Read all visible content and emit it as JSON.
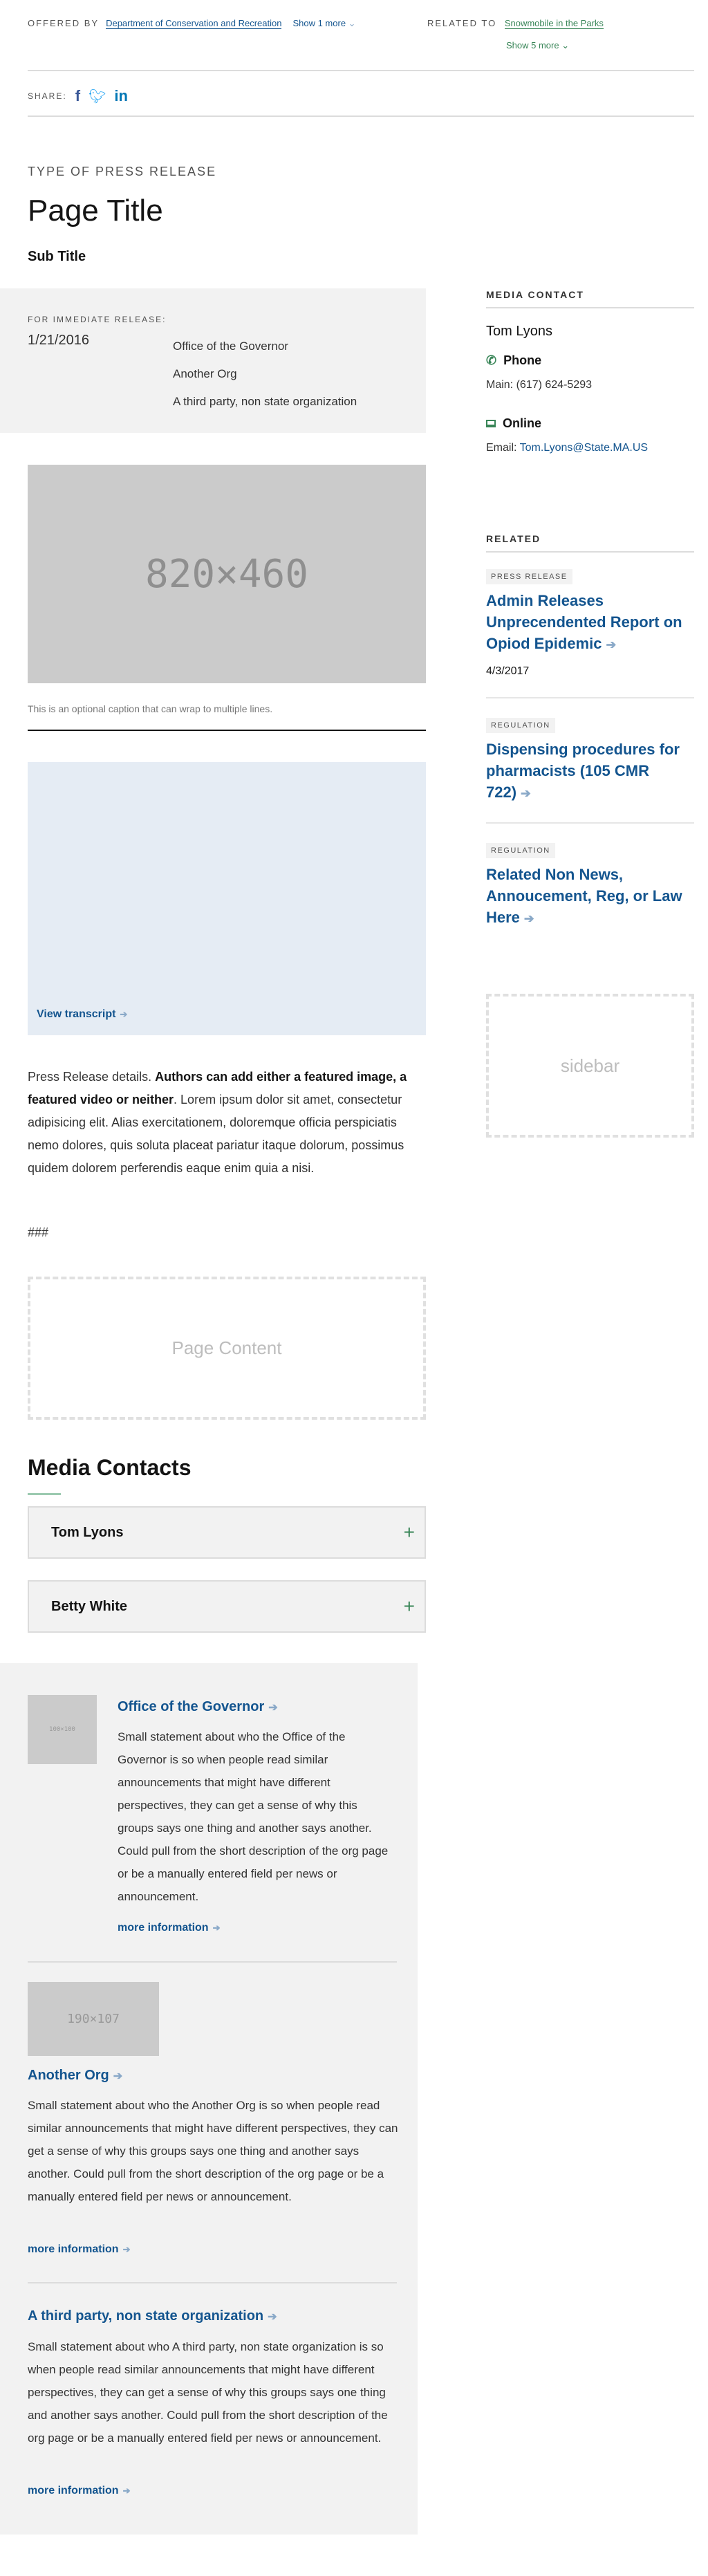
{
  "header": {
    "offered_by_label": "OFFERED BY",
    "offered_by_link": "Department of Conservation and Recreation",
    "offered_by_more": "Show 1 more",
    "related_to_label": "RELATED TO",
    "related_to_link": "Snowmobile in the Parks",
    "related_to_more": "Show 5 more",
    "share_label": "SHARE:",
    "share_icons": [
      "facebook-icon",
      "twitter-icon",
      "linkedin-icon"
    ]
  },
  "title_block": {
    "type": "TYPE OF PRESS RELEASE",
    "title": "Page Title",
    "subtitle": "Sub Title"
  },
  "release": {
    "label": "FOR IMMEDIATE RELEASE:",
    "date": "1/21/2016",
    "orgs": [
      "Office of the Governor",
      "Another Org",
      "A third party, non state organization"
    ]
  },
  "featured_image": {
    "placeholder": "820×460",
    "caption": "This is an optional caption that can wrap to multiple lines."
  },
  "video": {
    "transcript_link": "View transcript"
  },
  "body": {
    "intro": "Press Release details. ",
    "bold": "Authors can add either a featured image, a featured video or neither",
    "rest": ". Lorem ipsum dolor sit amet, consectetur adipisicing elit. Alias exercitationem, doloremque officia perspiciatis nemo dolores, quis soluta placeat pariatur itaque dolorum, possimus quidem dolorem perferendis eaque enim quia a nisi.",
    "end_mark": "###",
    "page_content": "Page Content"
  },
  "media_contacts": {
    "heading": "Media Contacts",
    "items": [
      "Tom Lyons",
      "Betty White"
    ]
  },
  "sidebar": {
    "media_contact_heading": "MEDIA CONTACT",
    "contact_name": "Tom Lyons",
    "phone_label": "Phone",
    "phone_prefix": "Main:",
    "phone": "(617) 624-5293",
    "online_label": "Online",
    "email_prefix": "Email:",
    "email": "Tom.Lyons@State.MA.US",
    "related_heading": "RELATED",
    "related": [
      {
        "tag": "PRESS RELEASE",
        "title": "Admin Releases Unprecendented Report on Opiod Epidemic",
        "date": "4/3/2017"
      },
      {
        "tag": "REGULATION",
        "title": "Dispensing procedures for pharmacists (105 CMR 722)"
      },
      {
        "tag": "REGULATION",
        "title": "Related Non News, Annoucement, Reg, or Law Here"
      }
    ],
    "placeholder": "sidebar"
  },
  "orgs_footer": [
    {
      "image": "100×100",
      "title": "Office of the Governor",
      "text": "Small statement about who the Office of the Governor is so when people read similar announcements that might have different perspectives, they can get a sense of why this groups says one thing and another says another. Could pull from the short description of the org page or be a manually entered field per news or announcement.",
      "more": "more information"
    },
    {
      "image": "190×107",
      "title": "Another Org",
      "text": "Small statement about who the Another Org is so when people read similar announcements that might have different perspectives, they can get a sense of why this groups says one thing and another says another. Could pull from the short description of the org page or be a manually entered field per news or announcement.",
      "more": "more information"
    },
    {
      "title": "A third party, non state organization",
      "text": "Small statement about who A third party, non state organization is so when people read similar announcements that might have different perspectives, they can get a sense of why this groups says one thing and another says another. Could pull from the short description of the org page or be a manually entered field per news or announcement.",
      "more": "more information"
    }
  ],
  "colors": {
    "link": "#14558f",
    "accent_green": "#388557",
    "panel": "#f2f2f2",
    "video_bg": "#e5ecf4"
  }
}
